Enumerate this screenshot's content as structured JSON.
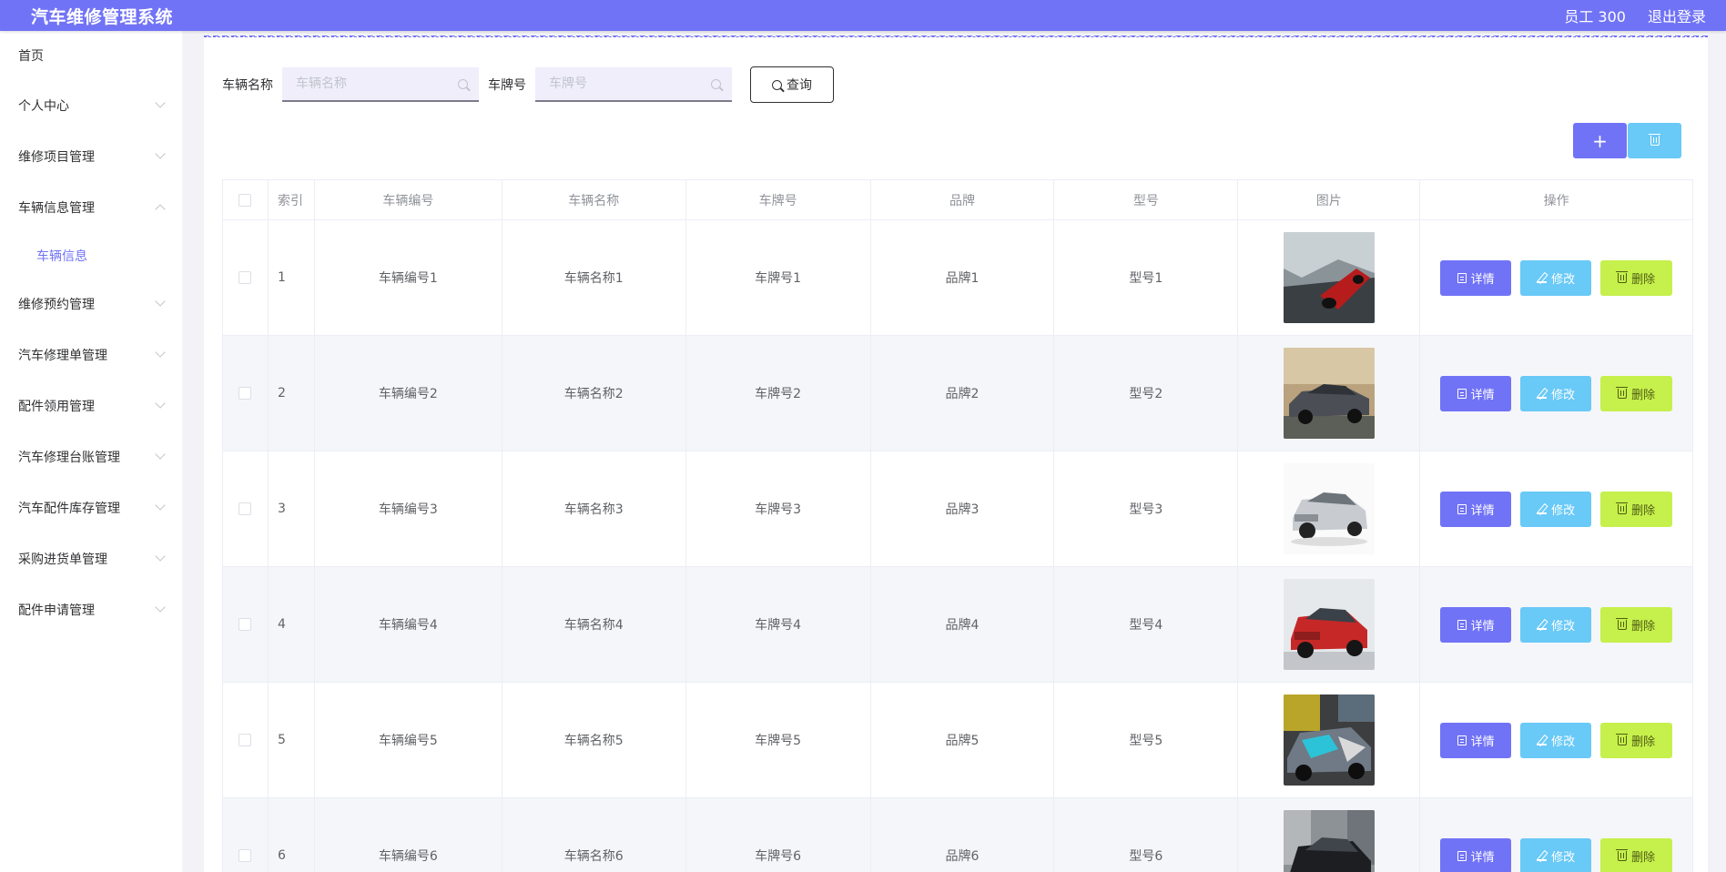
{
  "header": {
    "app_title": "汽车维修管理系统",
    "user": "员工 300",
    "logout": "退出登录"
  },
  "sidebar": {
    "items": [
      {
        "label": "首页",
        "expandable": false
      },
      {
        "label": "个人中心",
        "expandable": true
      },
      {
        "label": "维修项目管理",
        "expandable": true
      },
      {
        "label": "车辆信息管理",
        "expandable": true,
        "expanded": true
      },
      {
        "label": "维修预约管理",
        "expandable": true
      },
      {
        "label": "汽车修理单管理",
        "expandable": true
      },
      {
        "label": "配件领用管理",
        "expandable": true
      },
      {
        "label": "汽车修理台账管理",
        "expandable": true
      },
      {
        "label": "汽车配件库存管理",
        "expandable": true
      },
      {
        "label": "采购进货单管理",
        "expandable": true
      },
      {
        "label": "配件申请管理",
        "expandable": true
      }
    ],
    "submenu": {
      "label": "车辆信息",
      "active": true
    }
  },
  "search": {
    "name_label": "车辆名称",
    "name_placeholder": "车辆名称",
    "plate_label": "车牌号",
    "plate_placeholder": "车牌号",
    "query_label": "查询"
  },
  "toolbar": {
    "add_label": "+"
  },
  "table": {
    "columns": [
      "索引",
      "车辆编号",
      "车辆名称",
      "车牌号",
      "品牌",
      "型号",
      "图片",
      "操作"
    ],
    "rows": [
      {
        "index": "1",
        "code": "车辆编号1",
        "name": "车辆名称1",
        "plate": "车牌号1",
        "brand": "品牌1",
        "model": "型号1",
        "photo": "red-sports-car"
      },
      {
        "index": "2",
        "code": "车辆编号2",
        "name": "车辆名称2",
        "plate": "车牌号2",
        "brand": "品牌2",
        "model": "型号2",
        "photo": "grey-muscle-car"
      },
      {
        "index": "3",
        "code": "车辆编号3",
        "name": "车辆名称3",
        "plate": "车牌号3",
        "brand": "品牌3",
        "model": "型号3",
        "photo": "silver-suv"
      },
      {
        "index": "4",
        "code": "车辆编号4",
        "name": "车辆名称4",
        "plate": "车牌号4",
        "brand": "品牌4",
        "model": "型号4",
        "photo": "red-suv"
      },
      {
        "index": "5",
        "code": "车辆编号5",
        "name": "车辆名称5",
        "plate": "车牌号5",
        "brand": "品牌5",
        "model": "型号5",
        "photo": "wrapped-race-car"
      },
      {
        "index": "6",
        "code": "车辆编号6",
        "name": "车辆名称6",
        "plate": "车牌号6",
        "brand": "品牌6",
        "model": "型号6",
        "photo": "black-suv-street"
      }
    ],
    "actions": {
      "detail": "详情",
      "edit": "修改",
      "delete": "删除"
    }
  },
  "colors": {
    "accent": "#7173f6",
    "edit": "#69c9f7",
    "delete": "#c6f04c",
    "row_alt": "#f5f6fa"
  }
}
